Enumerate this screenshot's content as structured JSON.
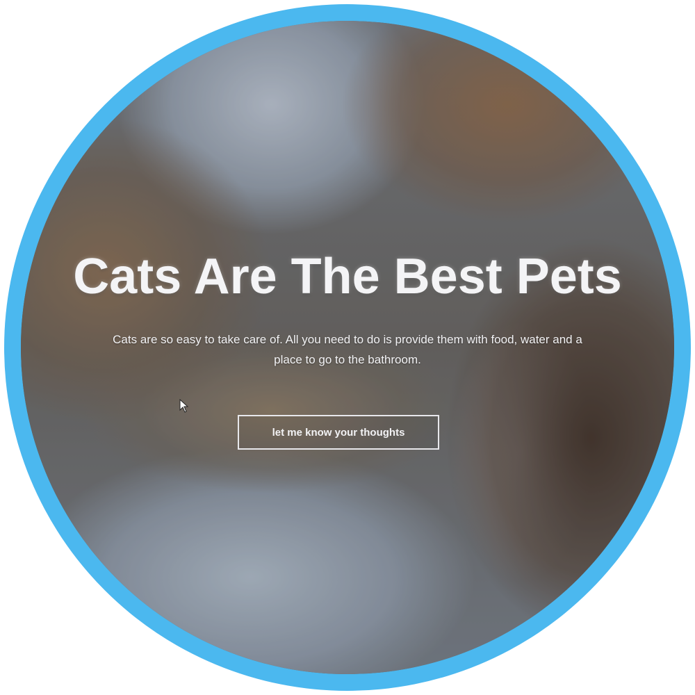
{
  "hero": {
    "title": "Cats Are The Best Pets",
    "subtitle": "Cats are so easy to take care of. All you need to do is provide them with food, water and a place to go to the bathroom.",
    "button_label": "let me know your thoughts"
  },
  "icons": {
    "cursor": "mouse-pointer-icon"
  },
  "colors": {
    "frame": "#4bb8ef",
    "text": "#f4f4f6"
  }
}
